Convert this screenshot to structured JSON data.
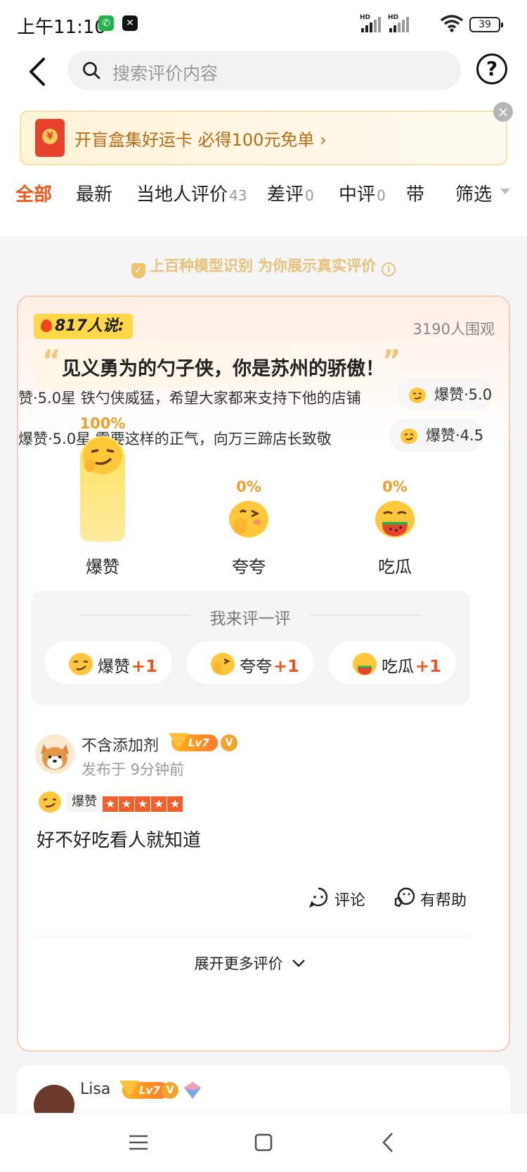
{
  "status_bar": {
    "time": "上午11:10",
    "battery": "39",
    "network_label": "HD"
  },
  "header": {
    "search_placeholder": "搜索评价内容",
    "help_label": "?"
  },
  "banner": {
    "text": "开盲盒集好运卡 必得100元免单 ›",
    "coin": "¥"
  },
  "tabs": [
    {
      "label": "全部",
      "count": "",
      "active": true
    },
    {
      "label": "最新",
      "count": ""
    },
    {
      "label": "当地人评价",
      "count": "43"
    },
    {
      "label": "差评",
      "count": "0"
    },
    {
      "label": "中评",
      "count": "0"
    },
    {
      "label": "带",
      "count": ""
    }
  ],
  "filter_label": "筛选",
  "trust_line": "上百种模型识别 为你展示真实评价",
  "highlight": {
    "badge": "817人说:",
    "watch_count": "3190人围观",
    "quote": "见义勇为的勺子侠，你是苏州的骄傲！",
    "marquee_row1": {
      "text": "赞·5.0星   铁勺侠威猛，希望大家都来支持下他的店铺",
      "pill": "爆赞·5.0"
    },
    "marquee_row2": {
      "text": "爆赞·5.0星   需要这样的正气，向万三蹄店长致敬",
      "pill": "爆赞·4.5"
    }
  },
  "reactions": [
    {
      "label": "爆赞",
      "percent": 100,
      "percent_label": "100%"
    },
    {
      "label": "夸夸",
      "percent": 0,
      "percent_label": "0%"
    },
    {
      "label": "吃瓜",
      "percent": 0,
      "percent_label": "0%"
    }
  ],
  "rate_panel": {
    "title": "我来评一评",
    "buttons": [
      {
        "label": "爆赞",
        "plus": "+1"
      },
      {
        "label": "夸夸",
        "plus": "+1"
      },
      {
        "label": "吃瓜",
        "plus": "+1"
      }
    ]
  },
  "review": {
    "username": "不含添加剂",
    "level": "Lv7",
    "verified": "V",
    "posted": "发布于  9分钟前",
    "tag": "爆赞",
    "stars": 5,
    "text": "好不好吃看人就知道",
    "comment_label": "评论",
    "helpful_label": "有帮助"
  },
  "expand_more": "展开更多评价",
  "next_review": {
    "username": "Lisa",
    "level": "Lv7",
    "verified": "V"
  },
  "colors": {
    "accent": "#f0571f",
    "gold": "#e6c27a",
    "card_border": "#f6cdb8"
  }
}
